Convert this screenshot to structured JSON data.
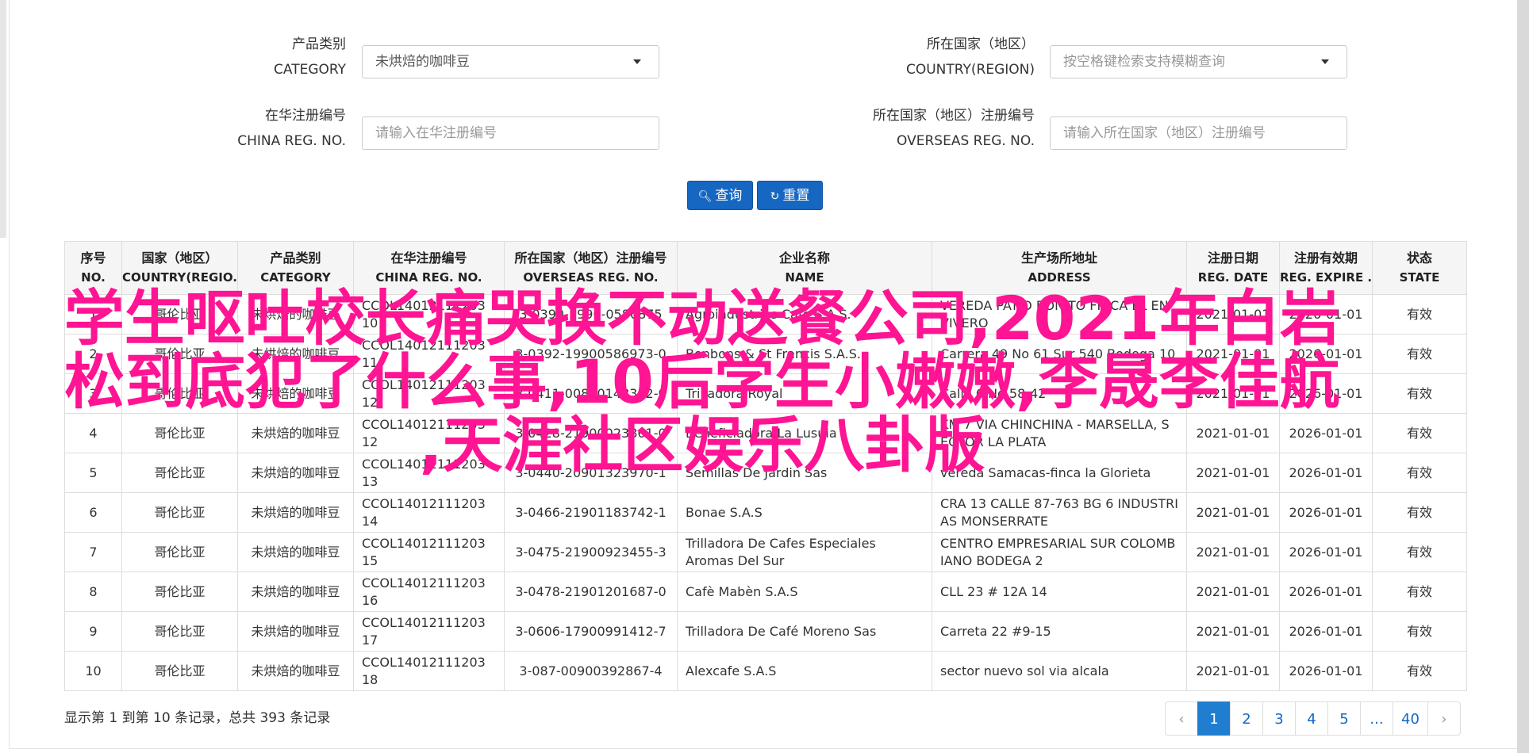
{
  "filters": {
    "category": {
      "label_cn": "产品类别",
      "label_en": "CATEGORY",
      "value": "未烘焙的咖啡豆"
    },
    "country": {
      "label_cn": "所在国家（地区）",
      "label_en": "COUNTRY(REGION)",
      "placeholder": "按空格键检索支持模糊查询"
    },
    "china_reg": {
      "label_cn": "在华注册编号",
      "label_en": "CHINA REG. NO.",
      "placeholder": "请输入在华注册编号"
    },
    "overseas_reg": {
      "label_cn": "所在国家（地区）注册编号",
      "label_en": "OVERSEAS REG. NO.",
      "placeholder": "请输入所在国家（地区）注册编号"
    }
  },
  "buttons": {
    "search": "查询",
    "reset": "重置"
  },
  "table": {
    "headers": [
      {
        "cn": "序号",
        "en": "NO."
      },
      {
        "cn": "国家（地区）",
        "en": "COUNTRY(REGIO..."
      },
      {
        "cn": "产品类别",
        "en": "CATEGORY"
      },
      {
        "cn": "在华注册编号",
        "en": "CHINA REG. NO."
      },
      {
        "cn": "所在国家（地区）注册编号",
        "en": "OVERSEAS REG. NO."
      },
      {
        "cn": "企业名称",
        "en": "NAME"
      },
      {
        "cn": "生产场所地址",
        "en": "ADDRESS"
      },
      {
        "cn": "注册日期",
        "en": "REG. DATE"
      },
      {
        "cn": "注册有效期",
        "en": "REG. EXPIRE ..."
      },
      {
        "cn": "状态",
        "en": "STATE"
      }
    ],
    "rows": [
      {
        "no": "1",
        "country": "哥伦比亚",
        "category": "未烘焙的咖啡豆",
        "china_reg": "CCOL14012111203 10",
        "overseas_reg": "3-0390-1990-0586875",
        "name": "Agroindustrias Café S.A.S.",
        "address": "VEREDA PATIO BONITO FINCA EL EN VIVERO",
        "reg_date": "2021-01-01",
        "expire": "2026-01-01",
        "state": "有效"
      },
      {
        "no": "2",
        "country": "哥伦比亚",
        "category": "未烘焙的咖啡豆",
        "china_reg": "CCOL14012111203 11",
        "overseas_reg": "3-0392-19900586973-0",
        "name": "Bonbons & St Francis S.A.S.",
        "address": "Carrera 49 No 61 Sur 540 Bodega 10",
        "reg_date": "2021-01-01",
        "expire": "2026-01-01",
        "state": "有效"
      },
      {
        "no": "3",
        "country": "哥伦比亚",
        "category": "未烘焙的咖啡豆",
        "china_reg": "CCOL14012111203 12",
        "overseas_reg": "3-0411-00800148332-0",
        "name": "Trilladora Royal",
        "address": "Calle 6 No 58-42",
        "reg_date": "2021-01-01",
        "expire": "2026-01-01",
        "state": "有效"
      },
      {
        "no": "4",
        "country": "哥伦比亚",
        "category": "未烘焙的咖啡豆",
        "china_reg": "CCOL14012111203 12",
        "overseas_reg": "3-0428-21900023861-0",
        "name": "Beneficiadora La Lusula",
        "address": "KM 7 VIA CHINCHINA - MARSELLA, S ECTOR LA PLATA",
        "reg_date": "2021-01-01",
        "expire": "2026-01-01",
        "state": "有效"
      },
      {
        "no": "5",
        "country": "哥伦比亚",
        "category": "未烘焙的咖啡豆",
        "china_reg": "CCOL14012111203 13",
        "overseas_reg": "3-0440-20901323970-1",
        "name": "Semillas De Jardin Sas",
        "address": "vereda Samacas-finca la Glorieta",
        "reg_date": "2021-01-01",
        "expire": "2026-01-01",
        "state": "有效"
      },
      {
        "no": "6",
        "country": "哥伦比亚",
        "category": "未烘焙的咖啡豆",
        "china_reg": "CCOL14012111203 14",
        "overseas_reg": "3-0466-21901183742-1",
        "name": "Bonae S.A.S",
        "address": "CRA 13 CALLE 87-763 BG 6 INDUSTRI AS MONSERRATE",
        "reg_date": "2021-01-01",
        "expire": "2026-01-01",
        "state": "有效"
      },
      {
        "no": "7",
        "country": "哥伦比亚",
        "category": "未烘焙的咖啡豆",
        "china_reg": "CCOL14012111203 15",
        "overseas_reg": "3-0475-21900923455-3",
        "name": "Trilladora De Cafes Especiales Aromas Del Sur",
        "address": "CENTRO EMPRESARIAL SUR COLOMB IANO BODEGA 2",
        "reg_date": "2021-01-01",
        "expire": "2026-01-01",
        "state": "有效"
      },
      {
        "no": "8",
        "country": "哥伦比亚",
        "category": "未烘焙的咖啡豆",
        "china_reg": "CCOL14012111203 16",
        "overseas_reg": "3-0478-21901201687-0",
        "name": "Cafè Mabèn S.A.S",
        "address": "CLL 23 # 12A 14",
        "reg_date": "2021-01-01",
        "expire": "2026-01-01",
        "state": "有效"
      },
      {
        "no": "9",
        "country": "哥伦比亚",
        "category": "未烘焙的咖啡豆",
        "china_reg": "CCOL14012111203 17",
        "overseas_reg": "3-0606-17900991412-7",
        "name": "Trilladora De Café Moreno Sas",
        "address": "Carreta 22 #9-15",
        "reg_date": "2021-01-01",
        "expire": "2026-01-01",
        "state": "有效"
      },
      {
        "no": "10",
        "country": "哥伦比亚",
        "category": "未烘焙的咖啡豆",
        "china_reg": "CCOL14012111203 18",
        "overseas_reg": "3-087-00900392867-4",
        "name": "Alexcafe S.A.S",
        "address": "sector nuevo sol via alcala",
        "reg_date": "2021-01-01",
        "expire": "2026-01-01",
        "state": "有效"
      }
    ]
  },
  "overlay": {
    "line1": "学生呕吐校长痛哭换不动送餐公司,2021年白岩",
    "line2": "松到底犯了什么事,10后学生小嫩嫩,李晟李佳航",
    "line3": ",天涯社区娱乐八卦版"
  },
  "summary": "显示第 1 到第 10 条记录，总共 393 条记录",
  "pagination": {
    "prev": "‹",
    "pages": [
      "1",
      "2",
      "3",
      "4",
      "5",
      "...",
      "40"
    ],
    "next": "›",
    "active": "1"
  },
  "colors": {
    "primary": "#1567c2",
    "overlay": "#ff1493"
  }
}
